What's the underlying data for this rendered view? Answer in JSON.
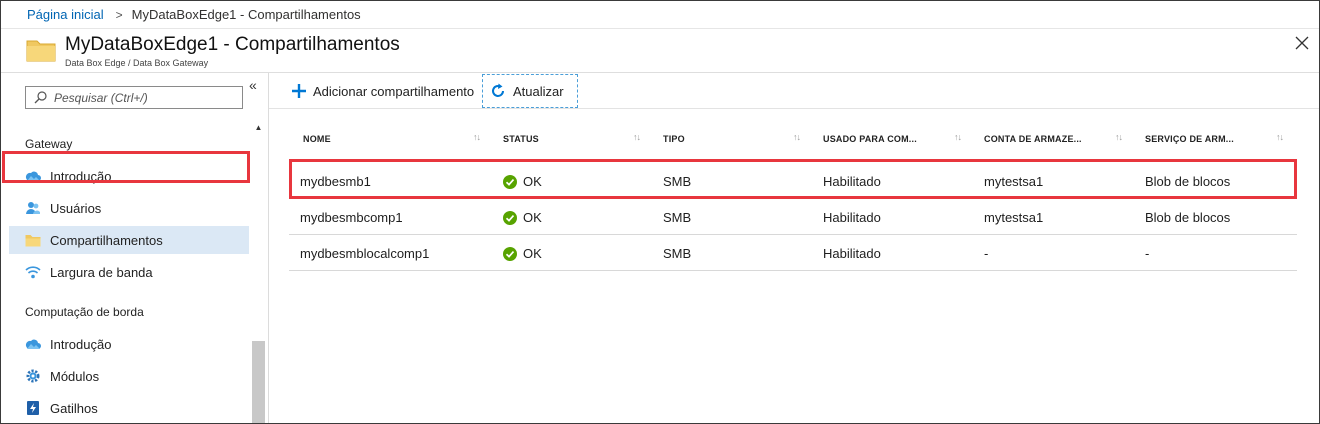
{
  "breadcrumb": {
    "home": "Página inicial",
    "current": "MyDataBoxEdge1 - Compartilhamentos"
  },
  "header": {
    "title": "MyDataBoxEdge1 - Compartilhamentos",
    "subtitle": "Data Box Edge / Data Box Gateway",
    "close_icon": "close-icon"
  },
  "sidebar": {
    "search_placeholder": "Pesquisar (Ctrl+/)",
    "collapse_glyph": "«",
    "groups": [
      {
        "label": "Gateway",
        "items": [
          {
            "label": "Introdução",
            "icon": "cloud-icon"
          },
          {
            "label": "Usuários",
            "icon": "users-icon"
          },
          {
            "label": "Compartilhamentos",
            "icon": "folder-icon",
            "active": true
          },
          {
            "label": "Largura de banda",
            "icon": "wifi-icon"
          }
        ]
      },
      {
        "label": "Computação de borda",
        "items": [
          {
            "label": "Introdução",
            "icon": "cloud-icon"
          },
          {
            "label": "Módulos",
            "icon": "gear-icon"
          },
          {
            "label": "Gatilhos",
            "icon": "trigger-icon"
          }
        ]
      }
    ]
  },
  "toolbar": {
    "add_label": "Adicionar compartilhamento",
    "refresh_label": "Atualizar"
  },
  "table": {
    "columns": [
      "NOME",
      "STATUS",
      "TIPO",
      "USADO PARA COM...",
      "CONTA DE ARMAZE...",
      "SERVIÇO DE ARM..."
    ],
    "rows": [
      {
        "name": "mydbesmb1",
        "status": "OK",
        "type": "SMB",
        "used_for": "Habilitado",
        "account": "mytestsa1",
        "service": "Blob de blocos",
        "highlighted": true
      },
      {
        "name": "mydbesmbcomp1",
        "status": "OK",
        "type": "SMB",
        "used_for": "Habilitado",
        "account": "mytestsa1",
        "service": "Blob de blocos"
      },
      {
        "name": "mydbesmblocalcomp1",
        "status": "OK",
        "type": "SMB",
        "used_for": "Habilitado",
        "account": "-",
        "service": "-"
      }
    ]
  },
  "colors": {
    "link": "#0065b3",
    "highlight": "#e8363e",
    "active_bg": "#dbe8f5",
    "ok_green": "#57a300",
    "azure_blue": "#0078d4"
  }
}
